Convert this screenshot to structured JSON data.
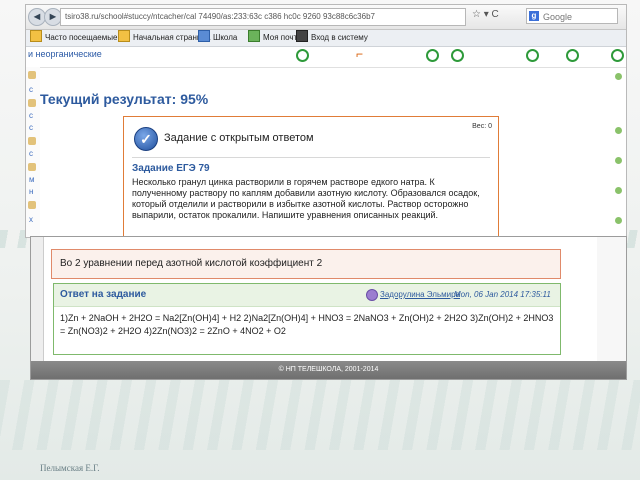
{
  "browser": {
    "url": "tsiro38.ru/school#stuccy/ntcacher/cal 74490/as:233:63c c386 hc0c 9260 93c88c6c36b7",
    "search_placeholder": "Google",
    "nav_back": "◄",
    "nav_fwd": "►",
    "toolbar_icons": "☆ ▾ C",
    "bookmarks": [
      {
        "label": "Часто посещаемые"
      },
      {
        "label": "Начальная страница"
      },
      {
        "label": "Школа"
      },
      {
        "label": "Моя почта"
      },
      {
        "label": "Вход в систему"
      }
    ]
  },
  "page": {
    "fragment_text": "и неорганические",
    "result_title": "Текущий результат: 95%",
    "left_letters": [
      "с",
      "с",
      "с",
      "с",
      "м",
      "н",
      "х"
    ],
    "task": {
      "header": "Задание с открытым ответом",
      "weight": "Вес: 0",
      "name": "Задание ЕГЭ 79",
      "text": "Несколько гранул цинка растворили в горячем растворе едкого натра. К полученному раствору по каплям добавили азотную кислоту. Образовался осадок, который отделили и растворили в избытке азотной кислоты. Раствор осторожно выпарили, остаток прокалили. Напишите уравнения описанных реакций."
    }
  },
  "answer": {
    "check_line": "Во 2 уравнении перед азотной кислотой коэффициент 2",
    "title": "Ответ на задание",
    "author": "Задорулина Эльмира",
    "date": "Mon, 06 Jan 2014 17:35:11",
    "text": "1)Zn + 2NaOH + 2H2O = Na2[Zn(OH)4] + H2 2)Na2[Zn(OH)4] + HNO3 = 2NaNO3 + Zn(OH)2 + 2H2O 3)Zn(OH)2 + 2HNO3 = Zn(NO3)2 + 2H2O 4)2Zn(NO3)2 = 2ZnO + 4NO2 + O2",
    "footer": "© НП ТЕЛЕШКОЛА, 2001-2014"
  },
  "slide": {
    "author": "Пелымская Е.Г."
  }
}
